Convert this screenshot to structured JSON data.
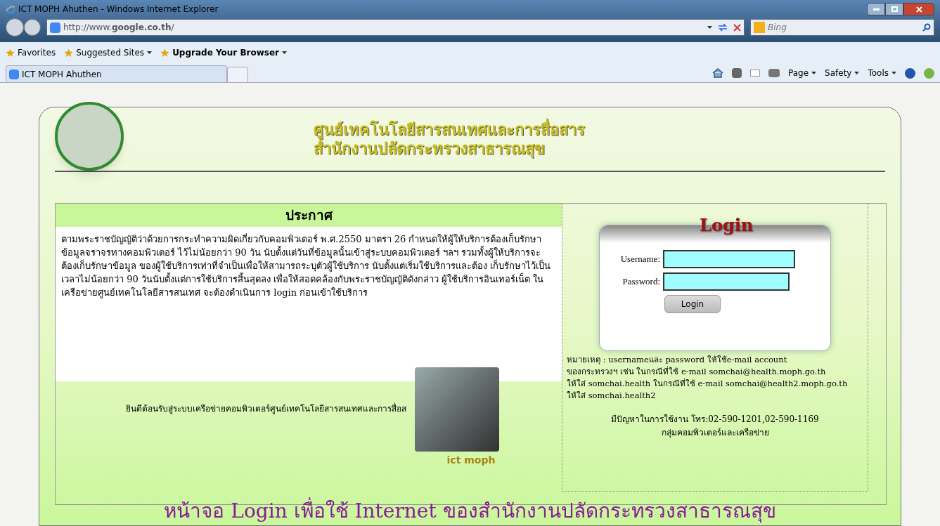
{
  "browser": {
    "title": "ICT MOPH Ahuthen - Windows Internet Explorer",
    "address": "http://www.**google.co.th**/",
    "search_placeholder": "Bing",
    "favorites": [
      {
        "label": "Favorites",
        "bold": false,
        "menu": false
      },
      {
        "label": "Suggested Sites",
        "bold": false,
        "menu": true
      },
      {
        "label": "Upgrade Your Browser",
        "bold": true,
        "menu": true
      }
    ],
    "tab": "ICT MOPH Ahuthen",
    "commands": [
      "Page",
      "Safety",
      "Tools"
    ]
  },
  "header": {
    "lines": [
      "ศูนย์เทคโนโลยีสารสนเทศและการสื่อสาร",
      "สำนักงานปลัดกระทรวงสาธารณสุข"
    ]
  },
  "notice": {
    "title": "ประกาศ",
    "body": "ตามพระราชบัญญัติว่าด้วยการกระทำความผิดเกี่ยวกับคอมพิวเตอร์ พ.ศ.2550 มาตรา 26 กำหนดให้ผู้ให้บริการต้องเก็บรักษาข้อมูลจราจรทางคอมพิวเตอร์ ไว้ไม่น้อยกว่า 90 วัน นับตั้งแต่วันที่ข้อมูลนั้นเข้าสู่ระบบคอมพิวเตอร์ ฯลฯ รวมทั้งผู้ให้บริการจะต้องเก็บรักษาข้อมูล ของผู้ใช้บริการเท่าที่จำเป็นเพื่อให้สามารถระบุตัวผู้ใช้บริการ นับตั้งแต่เริ่มใช้บริการและต้อง เก็บรักษาไว้เป็นเวลาไม่น้อยกว่า 90 วันนับตั้งแต่การใช้บริการสิ้นสุดลง เพื่อให้สอดคล้องกับพระราชบัญญัติดังกล่าว ผู้ใช้บริการอินเทอร์เน็ต ในเครือข่ายศูนย์เทคโนโลยีสารสนเทศ จะต้องดำเนินการ login ก่อนเข้าใช้บริการ",
    "marquee": "ยินดีต้อนรับสู่ระบบเครือข่ายคอมพิวเตอร์ศูนย์เทคโนโลยีสารสนเทศและการสื่อส",
    "logo_text": "ict moph"
  },
  "login": {
    "title": "Login",
    "fields": [
      {
        "label": "Username:"
      },
      {
        "label": "Password:"
      }
    ],
    "button": "Login"
  },
  "note": {
    "lines": [
      "หมายเหตุ : usernameและ password ให้ใช้e-mail account",
      "ของกระทรวงฯ เช่น ในกรณีที่ใช้ e-mail somchai@health.moph.go.th",
      "ให้ใส่ somchai.health ในกรณีที่ใช้ e-mail somchai@health2.moph.go.th",
      "ให้ใส่ somchai.health2"
    ]
  },
  "contact": {
    "lines": [
      "มีปัญหาในการใช้งาน โทร:02-590-1201,02-590-1169",
      "กลุ่มคอมพิวเตอร์และเครือข่าย"
    ]
  },
  "caption": "หน้าจอ Login เพื่อใช้ Internet ของสำนักงานปลัดกระทรวงสาธารณสุข"
}
